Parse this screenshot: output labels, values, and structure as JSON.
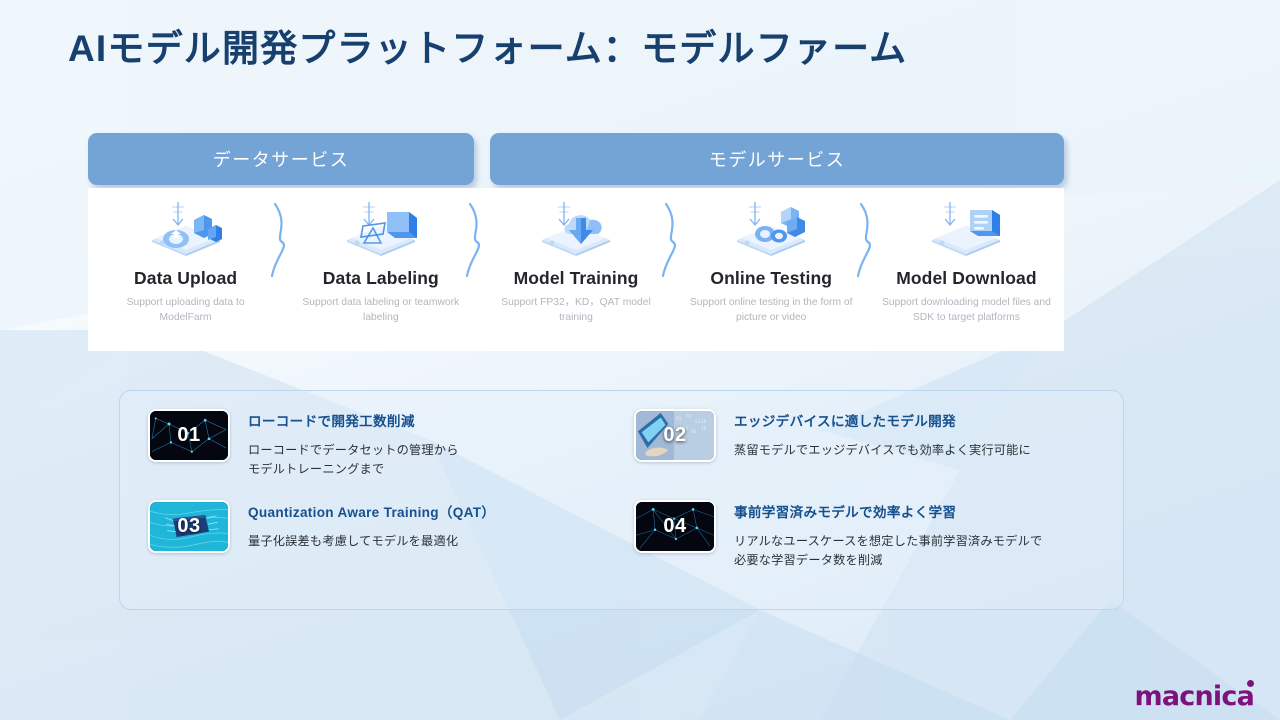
{
  "title": "AIモデル開発プラットフォーム：モデルファーム",
  "colors": {
    "title": "#17406e",
    "tab_bg": "#74a3d5",
    "feature_title": "#16508f",
    "card_border": "#bcd6ee",
    "logo": "#7d127d",
    "background": "#eef5fb"
  },
  "service_tabs": [
    {
      "label": "データサービス"
    },
    {
      "label": "モデルサービス"
    }
  ],
  "workflow": {
    "steps": [
      {
        "icon": "data-upload-icon",
        "title": "Data Upload",
        "desc": "Support uploading data to ModelFarm"
      },
      {
        "icon": "data-labeling-icon",
        "title": "Data Labeling",
        "desc": "Support data labeling or teamwork labeling"
      },
      {
        "icon": "model-training-icon",
        "title": "Model Training",
        "desc": "Support FP32，KD，QAT model training"
      },
      {
        "icon": "online-testing-icon",
        "title": "Online Testing",
        "desc": "Support online testing in the form of picture or video"
      },
      {
        "icon": "model-download-icon",
        "title": "Model Download",
        "desc": "Support downloading model files and SDK to target platforms"
      }
    ]
  },
  "features": [
    {
      "number": "01",
      "thumb": "neural-network-thumbnail",
      "title": "ローコードで開発工数削減",
      "desc_lines": [
        "ローコードでデータセットの管理から",
        "モデルトレーニングまで"
      ]
    },
    {
      "number": "02",
      "thumb": "tablet-device-thumbnail",
      "title": "エッジデバイスに適したモデル開発",
      "desc_lines": [
        "蒸留モデルでエッジデバイスでも効率よく実行可能に"
      ]
    },
    {
      "number": "03",
      "thumb": "chip-circuit-thumbnail",
      "title": "Quantization Aware Training（QAT）",
      "desc_lines": [
        "量子化誤差も考慮してモデルを最適化"
      ]
    },
    {
      "number": "04",
      "thumb": "network-mesh-thumbnail",
      "title": "事前学習済みモデルで効率よく学習",
      "desc_lines": [
        "リアルなユースケースを想定した事前学習済みモデルで",
        "必要な学習データ数を削減"
      ]
    }
  ],
  "brand": {
    "name": "macnica"
  }
}
